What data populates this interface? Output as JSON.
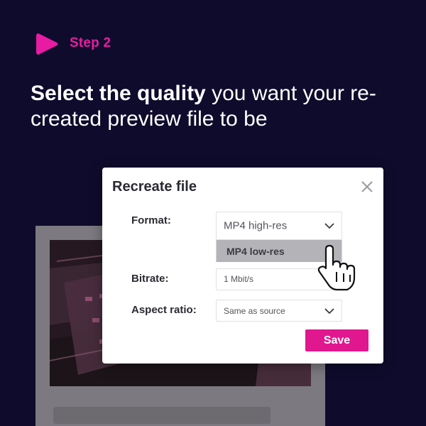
{
  "step": {
    "label": "Step 2",
    "icon": "play-icon",
    "color": "#e81ca2"
  },
  "headline": {
    "bold": "Select the quality",
    "rest": " you want your re-created preview file to be"
  },
  "dialog": {
    "title": "Recreate file",
    "close_icon": "close-icon",
    "format": {
      "label": "Format:",
      "value": "MP4 high-res",
      "highlighted_option": "MP4 low-res"
    },
    "bitrate": {
      "label": "Bitrate:",
      "value": "1 Mbit/s"
    },
    "aspect_ratio": {
      "label": "Aspect ratio:",
      "value": "Same as source"
    },
    "save_label": "Save"
  },
  "colors": {
    "background": "#0f0b2c",
    "accent": "#e0178f",
    "option_highlight": "#b4b4b8"
  },
  "cursor_icon": "hand-pointer-icon"
}
